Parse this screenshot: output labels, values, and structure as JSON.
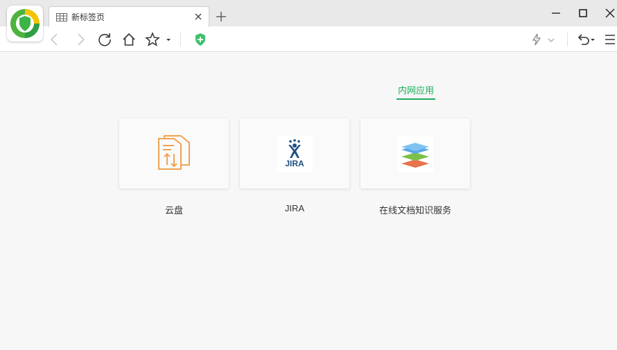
{
  "browser": {
    "tab": {
      "title": "新标签页"
    }
  },
  "section": {
    "tab_label": "内网应用"
  },
  "apps": [
    {
      "label": "云盘",
      "icon": "cloud-disk-icon"
    },
    {
      "label": "JIRA",
      "icon": "jira-icon",
      "logo_text": "JIRA"
    },
    {
      "label": "在线文档知识服务",
      "icon": "layers-icon"
    }
  ],
  "colors": {
    "accent": "#1aad5a",
    "jira_blue": "#205081",
    "cloud_orange": "#f0a352"
  }
}
